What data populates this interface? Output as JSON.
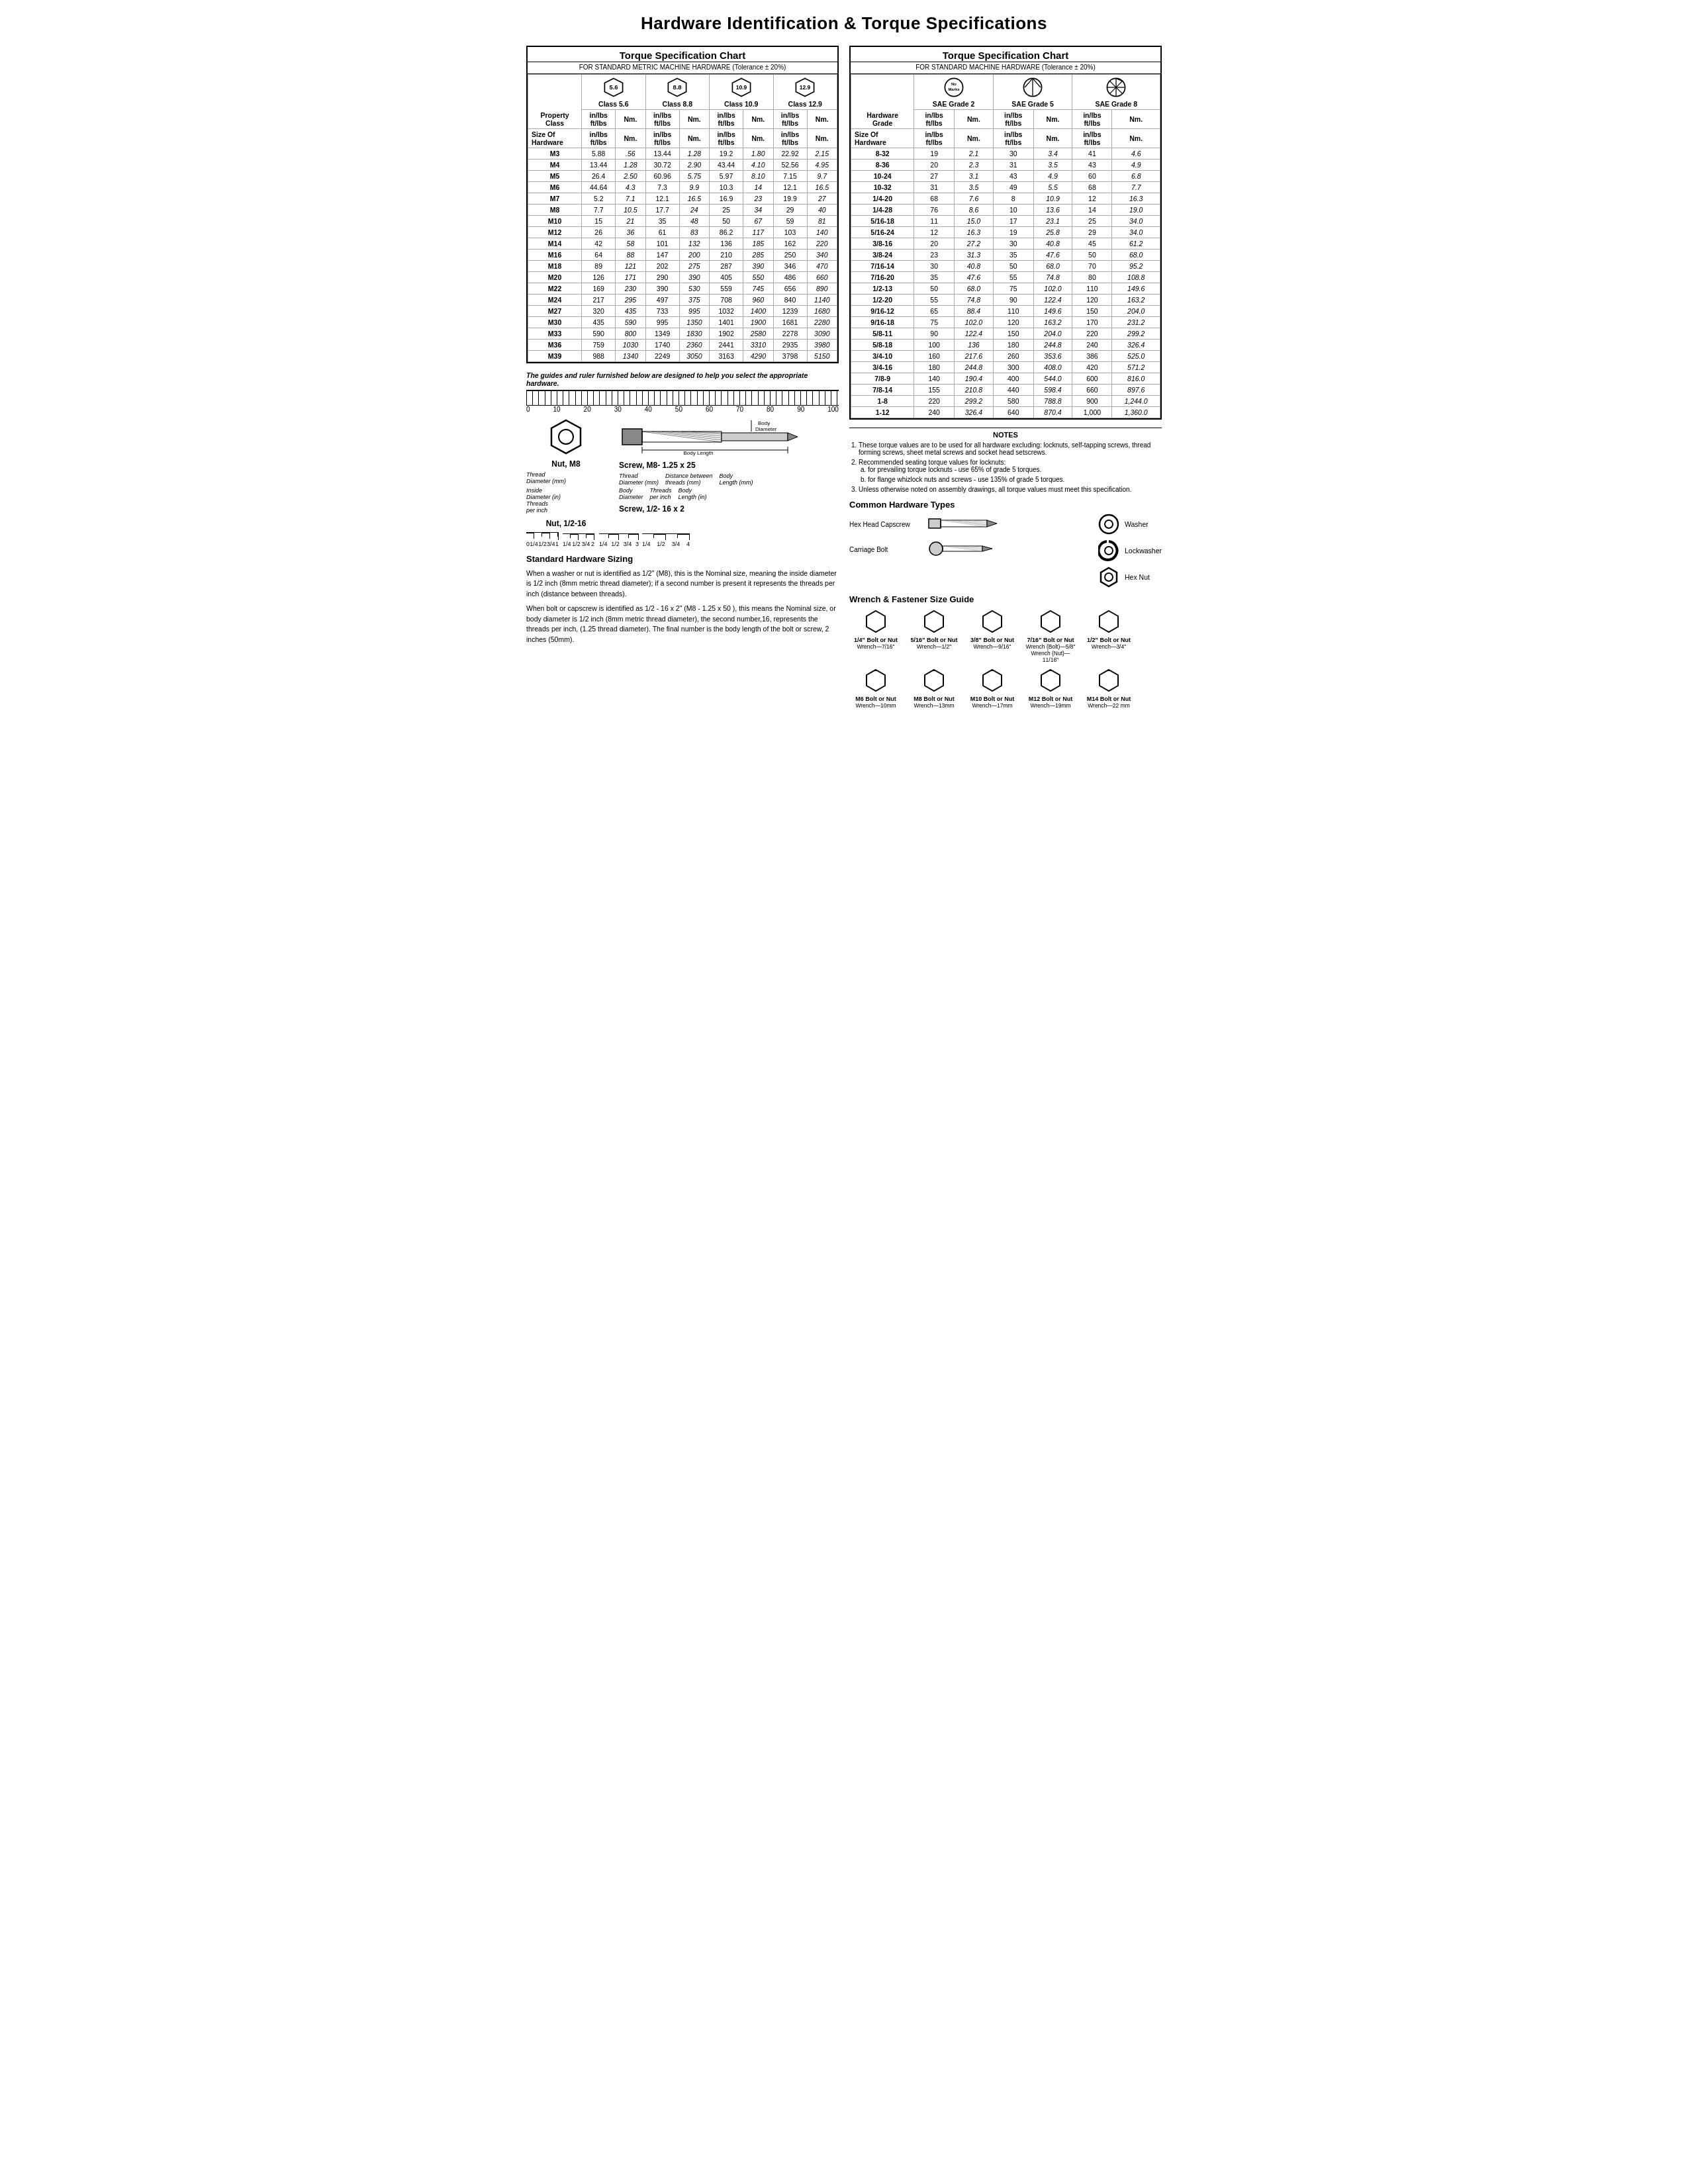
{
  "page": {
    "title": "Hardware Identification  &  Torque Specifications"
  },
  "left": {
    "metric_chart": {
      "title": "Torque Specification Chart",
      "subtitle": "FOR STANDARD METRIC MACHINE HARDWARE (Tolerance ± 20%)",
      "col_headers": {
        "property_class": "Property\nClass",
        "size": "Size Of\nHardware",
        "in_lbs": "in/lbs\nft/lbs",
        "nm": "Nm."
      },
      "classes": [
        {
          "label": "5.6",
          "sub": "Class 5.6"
        },
        {
          "label": "8.8",
          "sub": "Class 8.8"
        },
        {
          "label": "10.9",
          "sub": "Class 10.9"
        },
        {
          "label": "12.9",
          "sub": "Class 12.9"
        }
      ],
      "rows": [
        {
          "size": "M3",
          "c56_inlbs": "5.88",
          "c56_nm": ".56",
          "c88_inlbs": "13.44",
          "c88_nm": "1.28",
          "c109_inlbs": "19.2",
          "c109_nm": "1.80",
          "c129_inlbs": "22.92",
          "c129_nm": "2.15"
        },
        {
          "size": "M4",
          "c56_inlbs": "13.44",
          "c56_nm": "1.28",
          "c88_inlbs": "30.72",
          "c88_nm": "2.90",
          "c109_inlbs": "43.44",
          "c109_nm": "4.10",
          "c129_inlbs": "52.56",
          "c129_nm": "4.95"
        },
        {
          "size": "M5",
          "c56_inlbs": "26.4",
          "c56_nm": "2.50",
          "c88_inlbs": "60.96",
          "c88_nm": "5.75",
          "c109_inlbs": "5.97",
          "c109_nm": "8.10",
          "c129_inlbs": "7.15",
          "c129_nm": "9.7"
        },
        {
          "size": "M6",
          "c56_inlbs": "44.64",
          "c56_nm": "4.3",
          "c88_inlbs": "7.3",
          "c88_nm": "9.9",
          "c109_inlbs": "10.3",
          "c109_nm": "14",
          "c129_inlbs": "12.1",
          "c129_nm": "16.5"
        },
        {
          "size": "M7",
          "c56_inlbs": "5.2",
          "c56_nm": "7.1",
          "c88_inlbs": "12.1",
          "c88_nm": "16.5",
          "c109_inlbs": "16.9",
          "c109_nm": "23",
          "c129_inlbs": "19.9",
          "c129_nm": "27"
        },
        {
          "size": "M8",
          "c56_inlbs": "7.7",
          "c56_nm": "10.5",
          "c88_inlbs": "17.7",
          "c88_nm": "24",
          "c109_inlbs": "25",
          "c109_nm": "34",
          "c129_inlbs": "29",
          "c129_nm": "40"
        },
        {
          "size": "M10",
          "c56_inlbs": "15",
          "c56_nm": "21",
          "c88_inlbs": "35",
          "c88_nm": "48",
          "c109_inlbs": "50",
          "c109_nm": "67",
          "c129_inlbs": "59",
          "c129_nm": "81"
        },
        {
          "size": "M12",
          "c56_inlbs": "26",
          "c56_nm": "36",
          "c88_inlbs": "61",
          "c88_nm": "83",
          "c109_inlbs": "86.2",
          "c109_nm": "117",
          "c129_inlbs": "103",
          "c129_nm": "140"
        },
        {
          "size": "M14",
          "c56_inlbs": "42",
          "c56_nm": "58",
          "c88_inlbs": "101",
          "c88_nm": "132",
          "c109_inlbs": "136",
          "c109_nm": "185",
          "c129_inlbs": "162",
          "c129_nm": "220"
        },
        {
          "size": "M16",
          "c56_inlbs": "64",
          "c56_nm": "88",
          "c88_inlbs": "147",
          "c88_nm": "200",
          "c109_inlbs": "210",
          "c109_nm": "285",
          "c129_inlbs": "250",
          "c129_nm": "340"
        },
        {
          "size": "M18",
          "c56_inlbs": "89",
          "c56_nm": "121",
          "c88_inlbs": "202",
          "c88_nm": "275",
          "c109_inlbs": "287",
          "c109_nm": "390",
          "c129_inlbs": "346",
          "c129_nm": "470"
        },
        {
          "size": "M20",
          "c56_inlbs": "126",
          "c56_nm": "171",
          "c88_inlbs": "290",
          "c88_nm": "390",
          "c109_inlbs": "405",
          "c109_nm": "550",
          "c129_inlbs": "486",
          "c129_nm": "660"
        },
        {
          "size": "M22",
          "c56_inlbs": "169",
          "c56_nm": "230",
          "c88_inlbs": "390",
          "c88_nm": "530",
          "c109_inlbs": "559",
          "c109_nm": "745",
          "c129_inlbs": "656",
          "c129_nm": "890"
        },
        {
          "size": "M24",
          "c56_inlbs": "217",
          "c56_nm": "295",
          "c88_inlbs": "497",
          "c88_nm": "375",
          "c109_inlbs": "708",
          "c109_nm": "960",
          "c129_inlbs": "840",
          "c129_nm": "1140"
        },
        {
          "size": "M27",
          "c56_inlbs": "320",
          "c56_nm": "435",
          "c88_inlbs": "733",
          "c88_nm": "995",
          "c109_inlbs": "1032",
          "c109_nm": "1400",
          "c129_inlbs": "1239",
          "c129_nm": "1680"
        },
        {
          "size": "M30",
          "c56_inlbs": "435",
          "c56_nm": "590",
          "c88_inlbs": "995",
          "c88_nm": "1350",
          "c109_inlbs": "1401",
          "c109_nm": "1900",
          "c129_inlbs": "1681",
          "c129_nm": "2280"
        },
        {
          "size": "M33",
          "c56_inlbs": "590",
          "c56_nm": "800",
          "c88_inlbs": "1349",
          "c88_nm": "1830",
          "c109_inlbs": "1902",
          "c109_nm": "2580",
          "c129_inlbs": "2278",
          "c129_nm": "3090"
        },
        {
          "size": "M36",
          "c56_inlbs": "759",
          "c56_nm": "1030",
          "c88_inlbs": "1740",
          "c88_nm": "2360",
          "c109_inlbs": "2441",
          "c109_nm": "3310",
          "c129_inlbs": "2935",
          "c129_nm": "3980"
        },
        {
          "size": "M39",
          "c56_inlbs": "988",
          "c56_nm": "1340",
          "c88_inlbs": "2249",
          "c88_nm": "3050",
          "c109_inlbs": "3163",
          "c109_nm": "4290",
          "c129_inlbs": "3798",
          "c129_nm": "5150"
        }
      ]
    },
    "ruler_note": "The guides and ruler furnished below are designed to help you select the appropriate hardware.",
    "ruler_numbers": [
      "0",
      "10",
      "20",
      "30",
      "40",
      "50",
      "60",
      "70",
      "80",
      "90",
      "100"
    ],
    "nut_diagram": {
      "title_metric": "Nut, M8",
      "label1": "Thread",
      "label2": "Diameter (mm)",
      "label3": "Inside",
      "label4": "Diameter (in)",
      "label5": "Threads",
      "label6": "per inch",
      "title_imperial": "Nut, 1/2-16"
    },
    "screw_diagram": {
      "title_metric": "Screw, M8- 1.25 x 25",
      "label_body_dia": "Body\nDiameter",
      "label_body_len": "Body\nLength",
      "label_thread": "Thread\nDiameter (mm)",
      "label_dist": "Distance between\nthreads (mm)",
      "label_body_dia2": "Body\nDiameter",
      "label_threads_in": "Threads\nper inch",
      "label_body_len2": "Body\nLength (in)",
      "title_imperial": "Screw, 1/2- 16 x 2"
    },
    "sizing": {
      "title": "Standard Hardware Sizing",
      "p1": "When a washer or nut is identified as 1/2\" (M8), this is the Nominal size, meaning the inside diameter is 1/2 inch (8mm metric thread diameter); if a second number is present it represents the threads per inch (distance between threads).",
      "p2": "When bolt or capscrew is identified as 1/2 - 16 x 2\" (M8 - 1.25 x 50 ), this means the Nominal size, or body diameter is 1/2 inch (8mm metric thread diameter), the second number,16, represents the threads per inch, (1.25 thread diameter). The final number is the body length of the bolt or screw, 2 inches (50mm)."
    }
  },
  "right": {
    "std_chart": {
      "title": "Torque Specification Chart",
      "subtitle": "FOR STANDARD MACHINE HARDWARE (Tolerance ± 20%)",
      "grades": [
        {
          "label": "No\nMarks",
          "sub": "SAE Grade 2"
        },
        {
          "label": "SAE Grade 5"
        },
        {
          "label": "SAE Grade 8"
        }
      ],
      "col_headers": {
        "hardware_grade": "Hardware\nGrade",
        "size": "Size Of\nHardware",
        "in_lbs": "in/lbs\nft/lbs",
        "nm": "Nm."
      },
      "rows": [
        {
          "size": "8-32",
          "g2_inlbs": "19",
          "g2_nm": "2.1",
          "g5_inlbs": "30",
          "g5_nm": "3.4",
          "g8_inlbs": "41",
          "g8_nm": "4.6"
        },
        {
          "size": "8-36",
          "g2_inlbs": "20",
          "g2_nm": "2.3",
          "g5_inlbs": "31",
          "g5_nm": "3.5",
          "g8_inlbs": "43",
          "g8_nm": "4.9"
        },
        {
          "size": "10-24",
          "g2_inlbs": "27",
          "g2_nm": "3.1",
          "g5_inlbs": "43",
          "g5_nm": "4.9",
          "g8_inlbs": "60",
          "g8_nm": "6.8"
        },
        {
          "size": "10-32",
          "g2_inlbs": "31",
          "g2_nm": "3.5",
          "g5_inlbs": "49",
          "g5_nm": "5.5",
          "g8_inlbs": "68",
          "g8_nm": "7.7"
        },
        {
          "size": "1/4-20",
          "g2_inlbs": "68",
          "g2_nm": "7.6",
          "g5_inlbs": "8",
          "g5_nm": "10.9",
          "g8_inlbs": "12",
          "g8_nm": "16.3"
        },
        {
          "size": "1/4-28",
          "g2_inlbs": "76",
          "g2_nm": "8.6",
          "g5_inlbs": "10",
          "g5_nm": "13.6",
          "g8_inlbs": "14",
          "g8_nm": "19.0"
        },
        {
          "size": "5/16-18",
          "g2_inlbs": "11",
          "g2_nm": "15.0",
          "g5_inlbs": "17",
          "g5_nm": "23.1",
          "g8_inlbs": "25",
          "g8_nm": "34.0"
        },
        {
          "size": "5/16-24",
          "g2_inlbs": "12",
          "g2_nm": "16.3",
          "g5_inlbs": "19",
          "g5_nm": "25.8",
          "g8_inlbs": "29",
          "g8_nm": "34.0"
        },
        {
          "size": "3/8-16",
          "g2_inlbs": "20",
          "g2_nm": "27.2",
          "g5_inlbs": "30",
          "g5_nm": "40.8",
          "g8_inlbs": "45",
          "g8_nm": "61.2"
        },
        {
          "size": "3/8-24",
          "g2_inlbs": "23",
          "g2_nm": "31.3",
          "g5_inlbs": "35",
          "g5_nm": "47.6",
          "g8_inlbs": "50",
          "g8_nm": "68.0"
        },
        {
          "size": "7/16-14",
          "g2_inlbs": "30",
          "g2_nm": "40.8",
          "g5_inlbs": "50",
          "g5_nm": "68.0",
          "g8_inlbs": "70",
          "g8_nm": "95.2"
        },
        {
          "size": "7/16-20",
          "g2_inlbs": "35",
          "g2_nm": "47.6",
          "g5_inlbs": "55",
          "g5_nm": "74.8",
          "g8_inlbs": "80",
          "g8_nm": "108.8"
        },
        {
          "size": "1/2-13",
          "g2_inlbs": "50",
          "g2_nm": "68.0",
          "g5_inlbs": "75",
          "g5_nm": "102.0",
          "g8_inlbs": "110",
          "g8_nm": "149.6"
        },
        {
          "size": "1/2-20",
          "g2_inlbs": "55",
          "g2_nm": "74.8",
          "g5_inlbs": "90",
          "g5_nm": "122.4",
          "g8_inlbs": "120",
          "g8_nm": "163.2"
        },
        {
          "size": "9/16-12",
          "g2_inlbs": "65",
          "g2_nm": "88.4",
          "g5_inlbs": "110",
          "g5_nm": "149.6",
          "g8_inlbs": "150",
          "g8_nm": "204.0"
        },
        {
          "size": "9/16-18",
          "g2_inlbs": "75",
          "g2_nm": "102.0",
          "g5_inlbs": "120",
          "g5_nm": "163.2",
          "g8_inlbs": "170",
          "g8_nm": "231.2"
        },
        {
          "size": "5/8-11",
          "g2_inlbs": "90",
          "g2_nm": "122.4",
          "g5_inlbs": "150",
          "g5_nm": "204.0",
          "g8_inlbs": "220",
          "g8_nm": "299.2"
        },
        {
          "size": "5/8-18",
          "g2_inlbs": "100",
          "g2_nm": "136",
          "g5_inlbs": "180",
          "g5_nm": "244.8",
          "g8_inlbs": "240",
          "g8_nm": "326.4"
        },
        {
          "size": "3/4-10",
          "g2_inlbs": "160",
          "g2_nm": "217.6",
          "g5_inlbs": "260",
          "g5_nm": "353.6",
          "g8_inlbs": "386",
          "g8_nm": "525.0"
        },
        {
          "size": "3/4-16",
          "g2_inlbs": "180",
          "g2_nm": "244.8",
          "g5_inlbs": "300",
          "g5_nm": "408.0",
          "g8_inlbs": "420",
          "g8_nm": "571.2"
        },
        {
          "size": "7/8-9",
          "g2_inlbs": "140",
          "g2_nm": "190.4",
          "g5_inlbs": "400",
          "g5_nm": "544.0",
          "g8_inlbs": "600",
          "g8_nm": "816.0"
        },
        {
          "size": "7/8-14",
          "g2_inlbs": "155",
          "g2_nm": "210.8",
          "g5_inlbs": "440",
          "g5_nm": "598.4",
          "g8_inlbs": "660",
          "g8_nm": "897.6"
        },
        {
          "size": "1-8",
          "g2_inlbs": "220",
          "g2_nm": "299.2",
          "g5_inlbs": "580",
          "g5_nm": "788.8",
          "g8_inlbs": "900",
          "g8_nm": "1,244.0"
        },
        {
          "size": "1-12",
          "g2_inlbs": "240",
          "g2_nm": "326.4",
          "g5_inlbs": "640",
          "g5_nm": "870.4",
          "g8_inlbs": "1,000",
          "g8_nm": "1,360.0"
        }
      ]
    },
    "notes": {
      "title": "NOTES",
      "items": [
        "These torque values are to be used for all hardware excluding: locknuts, self-tapping screws, thread forming screws, sheet metal screws and socket head setscrews.",
        "Recommended seating torque values for locknuts:",
        "Unless otherwise noted on assembly drawings, all torque values must meet this specification."
      ],
      "sub_items_2a": "for prevailing torque locknuts - use 65% of grade 5 torques.",
      "sub_items_2b": "for flange whizlock nuts and screws - use 135% of grade 5 torques."
    },
    "hw_types": {
      "title": "Common Hardware Types",
      "items": [
        {
          "name": "Hex Head Capscrew",
          "right_name": "Washer"
        },
        {
          "name": "Carriage Bolt",
          "right_name": "Lockwasher"
        },
        {
          "name": "",
          "right_name": "Hex Nut"
        }
      ]
    },
    "wrench_guide": {
      "title": "Wrench & Fastener Size Guide",
      "inch_items": [
        {
          "label": "1/4\" Bolt or Nut",
          "sub": "Wrench—7/16\""
        },
        {
          "label": "5/16\" Bolt or Nut",
          "sub": "Wrench—1/2\""
        },
        {
          "label": "3/8\" Bolt or Nut",
          "sub": "Wrench—9/16\""
        },
        {
          "label": "7/16\" Bolt or Nut",
          "sub": "Wrench (Bolt)—5/8\"\nWrench (Nut)—11/16\""
        },
        {
          "label": "1/2\" Bolt or Nut",
          "sub": "Wrench—3/4\""
        }
      ],
      "mm_items": [
        {
          "label": "M6 Bolt or Nut",
          "sub": "Wrench—10mm"
        },
        {
          "label": "M8 Bolt or Nut",
          "sub": "Wrench—13mm"
        },
        {
          "label": "M10 Bolt or Nut",
          "sub": "Wrench—17mm"
        },
        {
          "label": "M12 Bolt or Nut",
          "sub": "Wrench—19mm"
        },
        {
          "label": "M14 Bolt or Nut",
          "sub": "Wrench—22 mm"
        }
      ]
    }
  }
}
